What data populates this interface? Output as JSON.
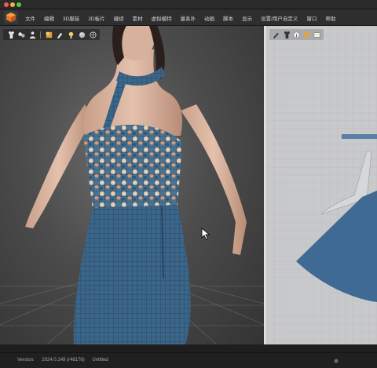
{
  "menu": {
    "items": [
      "文件",
      "编辑",
      "3D服装",
      "2D板片",
      "缝纫",
      "素材",
      "虚拟模特",
      "量系扑",
      "动画",
      "脚本",
      "显示",
      "设置/用户自定义",
      "窗口",
      "帮助"
    ]
  },
  "viewport3d": {
    "toolbar_icons": [
      "shirt-icon",
      "garment-multi-icon",
      "avatar-icon",
      "texture-icon",
      "brush-icon",
      "light-icon",
      "sphere-icon",
      "wireframe-icon"
    ]
  },
  "viewport2d": {
    "toolbar_icons": [
      "pen-icon",
      "shirt-icon",
      "circle-info-icon",
      "pattern-color-icon",
      "sewing-icon"
    ]
  },
  "status": {
    "version_label": "Version:",
    "version_value": "2024.0.149 (r48176)",
    "file_name": "Untitled"
  },
  "colors": {
    "fabric": "#3c6a8f",
    "pattern_2d": "#3f6a93",
    "menubar": "#2e2e2e"
  }
}
